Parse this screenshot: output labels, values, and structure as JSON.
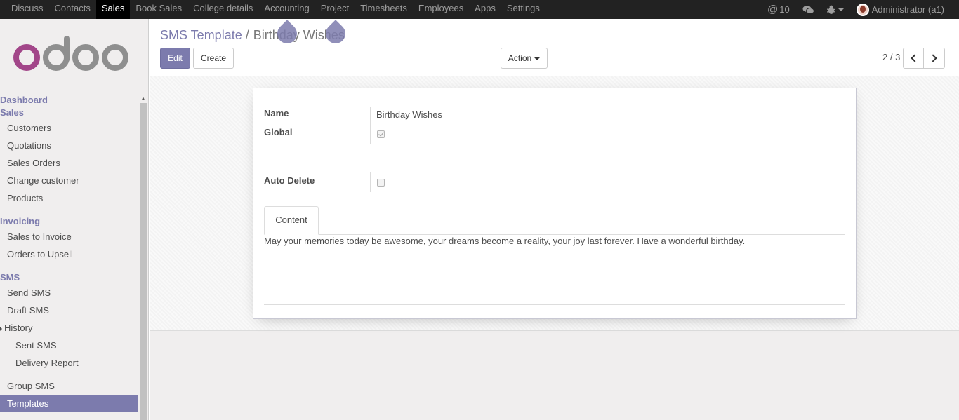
{
  "topbar": {
    "menu": [
      "Discuss",
      "Contacts",
      "Sales",
      "Book Sales",
      "College details",
      "Accounting",
      "Project",
      "Timesheets",
      "Employees",
      "Apps",
      "Settings"
    ],
    "active": "Sales",
    "mentions_count": "10",
    "user": "Administrator (a1)"
  },
  "sidebar": {
    "dashboard": "Dashboard",
    "sales_section": "Sales",
    "sales_items": [
      "Customers",
      "Quotations",
      "Sales Orders",
      "Change customer",
      "Products"
    ],
    "invoicing_section": "Invoicing",
    "invoicing_items": [
      "Sales to Invoice",
      "Orders to Upsell"
    ],
    "sms_section": "SMS",
    "sms_items": [
      "Send SMS",
      "Draft SMS"
    ],
    "history_group": "History",
    "history_items": [
      "Sent SMS",
      "Delivery Report"
    ],
    "sms_items_2": [
      "Group SMS",
      "Templates"
    ],
    "active_item": "Templates"
  },
  "control_panel": {
    "breadcrumb_parent": "SMS Template",
    "breadcrumb_separator": "/",
    "breadcrumb_current": "Birthday Wishes",
    "edit_label": "Edit",
    "create_label": "Create",
    "action_label": "Action",
    "pager_value": "2 / 3"
  },
  "form": {
    "name_label": "Name",
    "name_value": "Birthday Wishes",
    "global_label": "Global",
    "global_checked": true,
    "auto_delete_label": "Auto Delete",
    "auto_delete_checked": false,
    "tab_content_label": "Content",
    "content_text": "May your memories today be awesome, your dreams become a reality, your joy last forever. Have a wonderful birthday."
  },
  "colors": {
    "brand": "#7c7bad",
    "navbar": "#222222",
    "sidebar_bg": "#f0eeee"
  }
}
